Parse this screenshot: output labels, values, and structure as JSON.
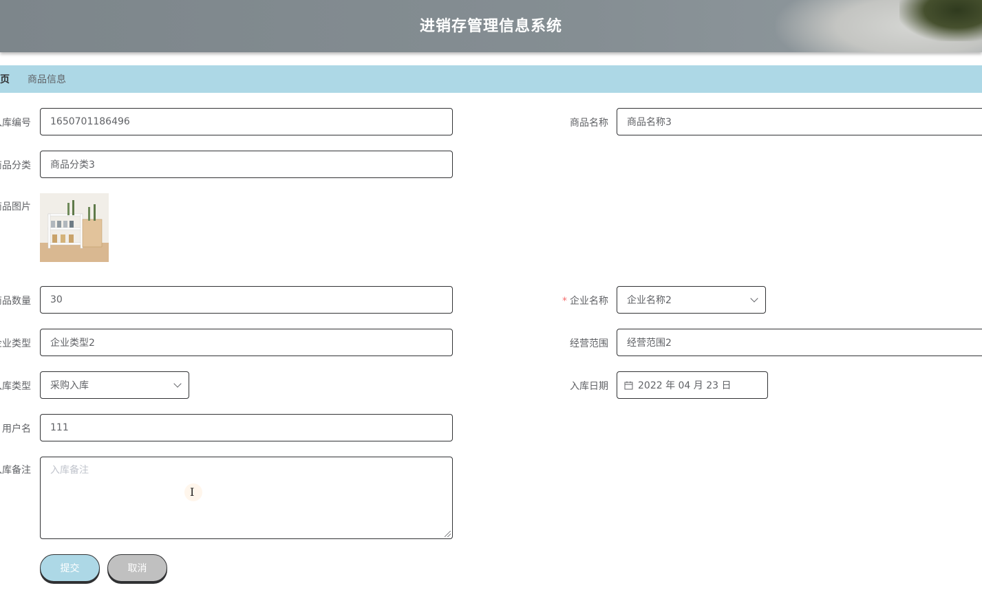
{
  "header": {
    "title": "进销存管理信息系统"
  },
  "breadcrumb": {
    "home": "页",
    "current": "商品信息"
  },
  "form": {
    "rukubianhao": {
      "label": "入库编号",
      "value": "1650701186496"
    },
    "shangpinmingcheng": {
      "label": "商品名称",
      "value": "商品名称3"
    },
    "shangpinfenlei": {
      "label": "商品分类",
      "value": "商品分类3"
    },
    "shangpintupian": {
      "label": "商品图片"
    },
    "shangpinshuliang": {
      "label": "商品数量",
      "value": "30"
    },
    "qiyemingcheng": {
      "label": "企业名称",
      "required_mark": "*",
      "value": "企业名称2"
    },
    "qiyeleixing": {
      "label": "企业类型",
      "value": "企业类型2"
    },
    "jingyingfanwei": {
      "label": "经营范围",
      "value": "经营范围2"
    },
    "rukuleixing": {
      "label": "入库类型",
      "value": "采购入库"
    },
    "rukuriqi": {
      "label": "入库日期",
      "value": "2022 年 04 月 23 日"
    },
    "yonghuming": {
      "label": "用户名",
      "value": "111"
    },
    "rukubeizhu": {
      "label": "入库备注",
      "placeholder": "入库备注"
    }
  },
  "buttons": {
    "submit": "提交",
    "cancel": "取消"
  },
  "colors": {
    "breadcrumb_bg": "#add8e6",
    "submit_bg": "#add8e6",
    "cancel_bg": "#c0c0c0",
    "required": "#f56c6c"
  }
}
